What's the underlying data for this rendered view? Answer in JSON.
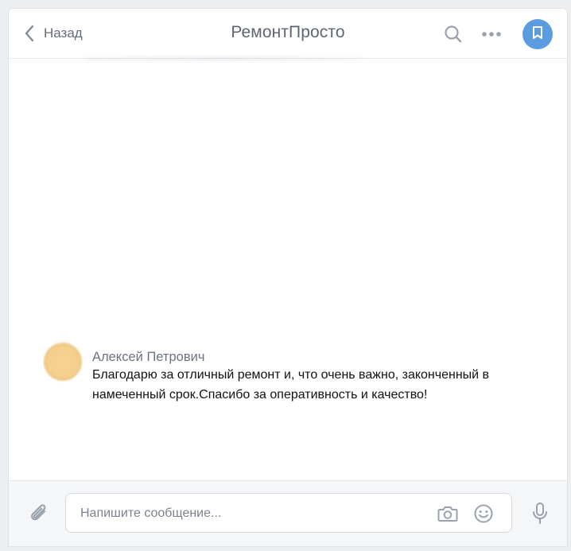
{
  "header": {
    "back_label": "Назад",
    "title": "РемонтПросто",
    "icons": [
      "chevron-left-icon",
      "search-icon",
      "more-icon",
      "bookmark-icon"
    ]
  },
  "message": {
    "author": "Алексей Петрович",
    "text": "Благодарю за отличный ремонт и, что очень важно, законченный в намеченный срок.Спасибо за оперативность и качество!"
  },
  "composer": {
    "placeholder": "Напишите сообщение...",
    "icons": [
      "paperclip-icon",
      "camera-icon",
      "emoji-icon",
      "microphone-icon"
    ]
  },
  "colors": {
    "accent": "#5b9be0",
    "background": "#edeef0",
    "icon": "#aeb7c2"
  }
}
